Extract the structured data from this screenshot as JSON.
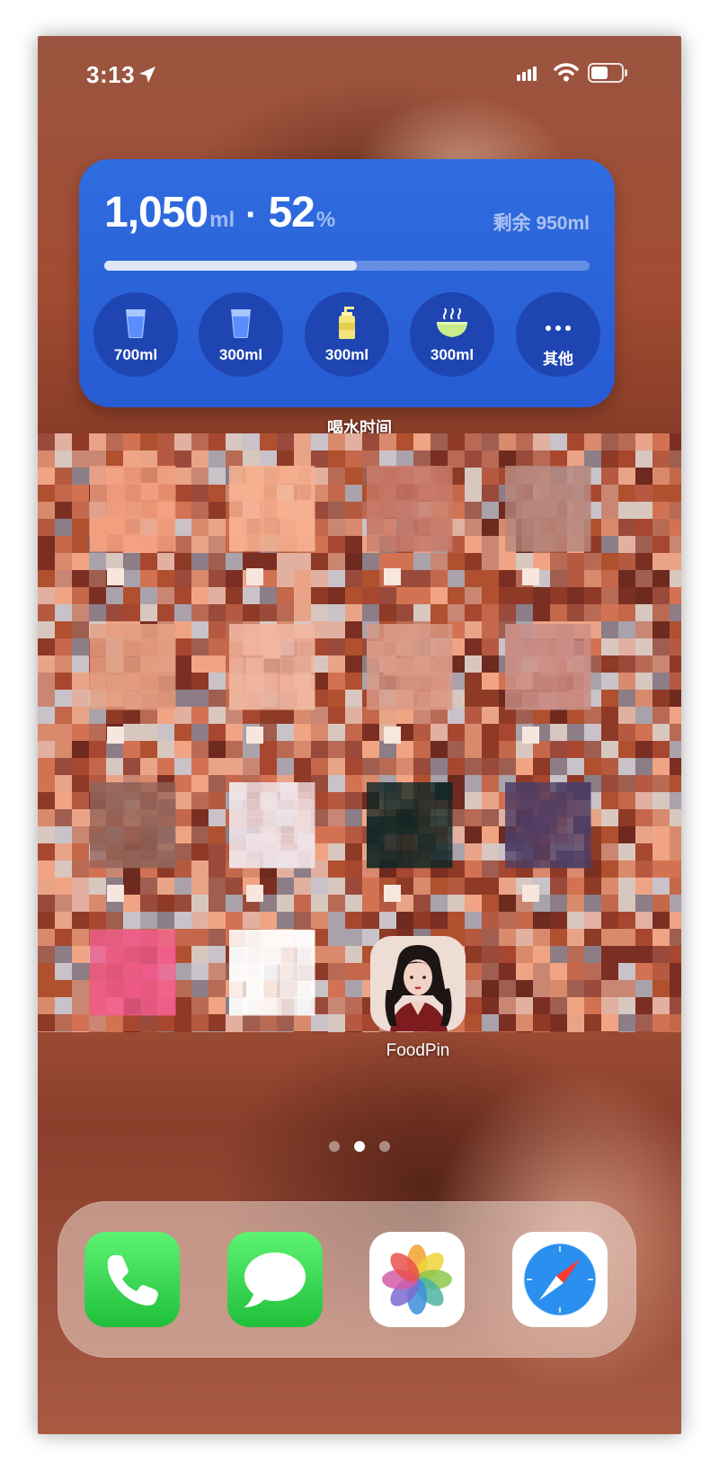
{
  "status_bar": {
    "time": "3:13",
    "battery_level": 0.6
  },
  "water_widget": {
    "consumed": "1,050",
    "consumed_unit": "ml",
    "separator": "·",
    "percent": "52",
    "percent_unit": "%",
    "progress": 0.52,
    "remaining": "剩余 950ml",
    "caption": "喝水时间",
    "accent_color": "#2f6de0",
    "buttons": [
      {
        "label": "700ml",
        "icon": "water-glass-icon"
      },
      {
        "label": "300ml",
        "icon": "water-glass-icon"
      },
      {
        "label": "300ml",
        "icon": "juice-bottle-icon"
      },
      {
        "label": "300ml",
        "icon": "soup-bowl-icon"
      },
      {
        "label": "其他",
        "icon": "more-dots-icon"
      }
    ]
  },
  "apps": [
    {
      "label": "FoodPin",
      "icon": "portrait-avatar-icon"
    }
  ],
  "page_indicator": {
    "pages": 3,
    "current_page": 2
  },
  "dock": {
    "apps": [
      {
        "name": "phone-app-icon",
        "color": "#34c759"
      },
      {
        "name": "messages-app-icon",
        "color": "#34c759"
      },
      {
        "name": "photos-app-icon",
        "color": "#ffffff"
      },
      {
        "name": "safari-app-icon",
        "color": "#1e8cf0"
      }
    ]
  }
}
